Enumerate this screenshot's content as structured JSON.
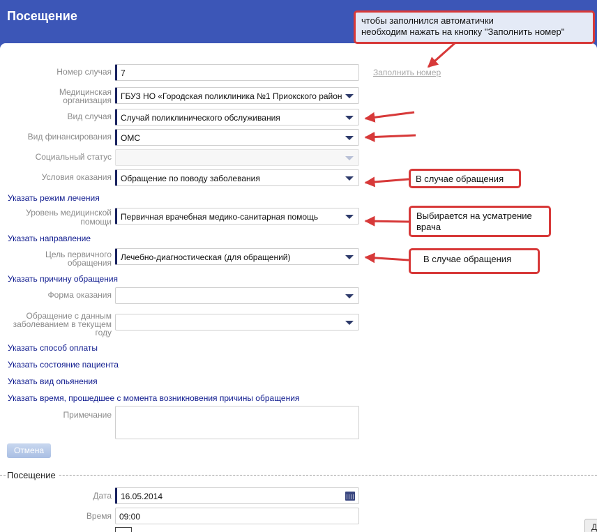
{
  "header": {
    "title": "Посещение"
  },
  "form": {
    "case_number": {
      "label": "Номер случая",
      "value": "7",
      "fill_link": "Заполнить номер"
    },
    "organization": {
      "label_line1": "Медицинская",
      "label_line2": "организация",
      "value": "ГБУЗ НО «Городская поликлиника №1 Приокского район"
    },
    "case_type": {
      "label": "Вид случая",
      "value": "Случай поликлинического обслуживания"
    },
    "financing": {
      "label": "Вид финансирования",
      "value": "ОМС"
    },
    "social_status": {
      "label": "Социальный статус",
      "value": ""
    },
    "conditions": {
      "label": "Условия оказания",
      "value": "Обращение по поводу заболевания"
    },
    "treatment_mode_link": "Указать режим лечения",
    "care_level": {
      "label_line1": "Уровень медицинской",
      "label_line2": "помощи",
      "value": "Первичная врачебная медико-санитарная помощь"
    },
    "direction_link": "Указать направление",
    "primary_goal": {
      "label_line1": "Цель первичного",
      "label_line2": "обращения",
      "value": "Лечебно-диагностическая (для обращений)"
    },
    "reason_link": "Указать причину обращения",
    "care_form": {
      "label": "Форма оказания",
      "value": ""
    },
    "appeal_year": {
      "label_line1": "Обращение с данным",
      "label_line2": "заболеванием в текущем",
      "label_line3": "году",
      "value": ""
    },
    "payment_link": "Указать способ оплаты",
    "patient_state_link": "Указать состояние пациента",
    "intoxication_link": "Указать вид опьянения",
    "elapsed_time_link": "Указать время, прошедшее с момента возникновения причины обращения",
    "note": {
      "label": "Примечание",
      "value": ""
    },
    "cancel_label": "Отмена"
  },
  "visit": {
    "section_title": "Посещение",
    "date": {
      "label": "Дата",
      "value": "16.05.2014"
    },
    "time": {
      "label": "Время",
      "value": "09:00"
    },
    "right_button_label": "Д"
  },
  "annotations": {
    "top_line1": "чтобы заполнился автоматички",
    "top_line2": "необходим нажать на кнопку \"Заполнить номер\"",
    "conditions_note": "В случае обращения",
    "level_line1": "Выбирается на усматрение",
    "level_line2": "врача",
    "goal_note": "В случае обращения"
  },
  "colors": {
    "header": "#3c56b7",
    "link": "#0e1a8e",
    "annotation": "#d73939"
  }
}
